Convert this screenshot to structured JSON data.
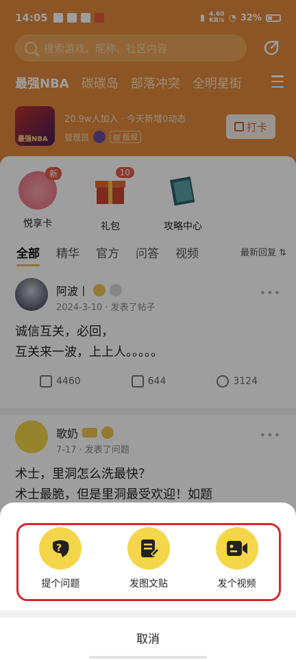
{
  "status_bar": {
    "time": "14:05",
    "net_speed_top": "4.60",
    "net_speed_unit": "KB/s",
    "battery": "32%"
  },
  "search": {
    "placeholder": "搜索游戏、昵称、社区内容"
  },
  "channels": [
    "最强NBA",
    "碳碳岛",
    "部落冲突",
    "全明星街"
  ],
  "game": {
    "logo_text": "最强NBA",
    "stats": "20.9w人加入 · 今天新增0动态",
    "admin_label": "管理员",
    "rules_label": "版规",
    "checkin_label": "打卡"
  },
  "shortcuts": [
    {
      "label": "悦享卡",
      "badge": "新"
    },
    {
      "label": "礼包",
      "badge": "10"
    },
    {
      "label": "攻略中心",
      "badge": ""
    }
  ],
  "tabs": [
    "全部",
    "精华",
    "官方",
    "问答",
    "视频"
  ],
  "sort_label": "最新回复",
  "posts": [
    {
      "author": "阿波丨",
      "meta": "2024-3-10 · 发表了帖子",
      "line1": "诚信互关，必回，",
      "line2": "互关来一波，上上人。。。。。",
      "shares": "4460",
      "comments": "644",
      "likes": "3124"
    },
    {
      "author": "歌奶",
      "meta": "7-17 · 发表了问题",
      "line1": "术士，里洞怎么洗最快？",
      "line2": "术士最脆，但是里洞最受欢迎！如题"
    }
  ],
  "sheet": {
    "options": [
      {
        "label": "提个问题",
        "icon": "ask-question-icon"
      },
      {
        "label": "发图文贴",
        "icon": "write-post-icon"
      },
      {
        "label": "发个视频",
        "icon": "video-camera-icon"
      }
    ],
    "cancel_label": "取消",
    "highlight_color": "#d9232d",
    "option_color": "#f5d64b"
  },
  "colors": {
    "header": "#e08a3c",
    "accent": "#ecc23e"
  }
}
